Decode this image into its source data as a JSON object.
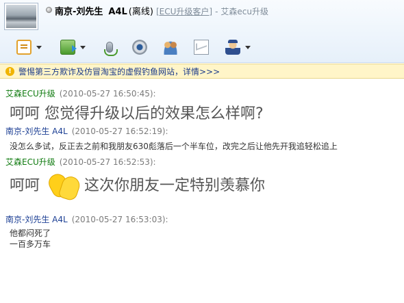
{
  "header": {
    "contact_name": "南京-刘先生",
    "contact_model": "A4L",
    "contact_status": "(离线)",
    "contact_group": "[ECU升级客户]",
    "separator": "-",
    "shop_name": "艾森ecu升级"
  },
  "toolbar": {
    "items": [
      {
        "icon": "chat-icon",
        "has_menu": true
      },
      {
        "icon": "file-transfer-icon",
        "has_menu": true
      },
      {
        "icon": "microphone-icon",
        "has_menu": false
      },
      {
        "icon": "webcam-icon",
        "has_menu": false
      },
      {
        "icon": "group-icon",
        "has_menu": false
      },
      {
        "icon": "mail-icon",
        "has_menu": false
      },
      {
        "icon": "security-officer-icon",
        "has_menu": true
      }
    ]
  },
  "warning": {
    "icon": "warning-icon",
    "text": "警惕第三方欺诈及仿冒淘宝的虚假钓鱼网站，详情>>>"
  },
  "messages": [
    {
      "sender": "艾森ECU升级",
      "time": "(2010-05-27 16:50:45):",
      "text": "呵呵  您觉得升级以后的效果怎么样啊?"
    },
    {
      "sender": "南京-刘先生",
      "sender_model": "A4L",
      "time": "(2010-05-27 16:52:19):",
      "text": "没怎么多试，反正去之前和我朋友630彪落后一个半车位，改完之后让他先开我追轻松追上"
    },
    {
      "sender": "艾森ECU升级",
      "time": "(2010-05-27 16:52:53):",
      "text_before": "呵呵",
      "emoticon": "clapping-hands-icon",
      "text_after": "这次你朋友一定特别羡慕你"
    },
    {
      "sender": "南京-刘先生",
      "sender_model": "A4L",
      "time": "(2010-05-27 16:53:03):",
      "lines": [
        "他都闷死了",
        "一百多万车"
      ]
    }
  ],
  "colors": {
    "self_sender": "#0e7a0e",
    "other_sender": "#1c3f94",
    "warning_bg": "#fff5c8"
  }
}
